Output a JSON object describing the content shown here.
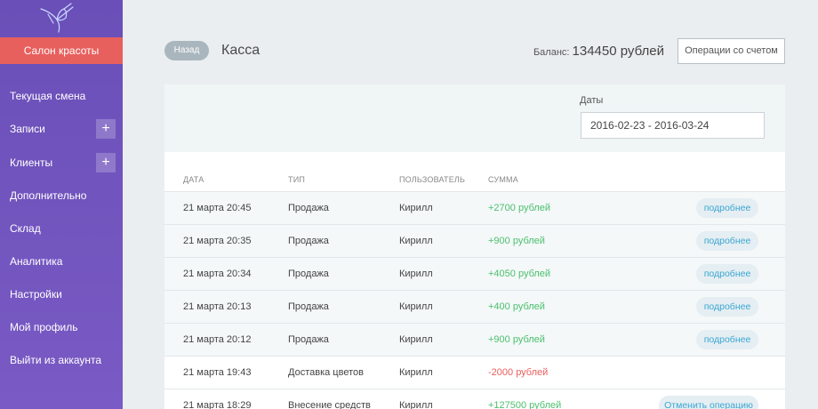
{
  "sidebar": {
    "salon_label": "Салон красоты",
    "items": [
      {
        "label": "Текущая смена",
        "has_plus": false
      },
      {
        "label": "Записи",
        "has_plus": true
      },
      {
        "label": "Клиенты",
        "has_plus": true
      },
      {
        "label": "Дополнительно",
        "has_plus": false
      },
      {
        "label": "Склад",
        "has_plus": false
      },
      {
        "label": "Аналитика",
        "has_plus": false
      },
      {
        "label": "Настройки",
        "has_plus": false
      },
      {
        "label": "Мой профиль",
        "has_plus": false
      },
      {
        "label": "Выйти из аккаунта",
        "has_plus": false
      }
    ],
    "plus_symbol": "+"
  },
  "header": {
    "back_label": "Назад",
    "title": "Касса",
    "balance_label": "Баланс:",
    "balance_value": "134450 рублей",
    "ops_button": "Операции со счетом"
  },
  "filter": {
    "dates_label": "Даты",
    "dates_value": "2016-02-23 - 2016-03-24"
  },
  "table": {
    "columns": [
      "Дата",
      "Тип",
      "Пользователь",
      "Сумма"
    ],
    "rows": [
      {
        "date": "21 марта 20:45",
        "type": "Продажа",
        "user": "Кирилл",
        "amount": "+2700 рублей",
        "positive": true,
        "action": "подробнее"
      },
      {
        "date": "21 марта 20:35",
        "type": "Продажа",
        "user": "Кирилл",
        "amount": "+900 рублей",
        "positive": true,
        "action": "подробнее"
      },
      {
        "date": "21 марта 20:34",
        "type": "Продажа",
        "user": "Кирилл",
        "amount": "+4050 рублей",
        "positive": true,
        "action": "подробнее"
      },
      {
        "date": "21 марта 20:13",
        "type": "Продажа",
        "user": "Кирилл",
        "amount": "+400 рублей",
        "positive": true,
        "action": "подробнее"
      },
      {
        "date": "21 марта 20:12",
        "type": "Продажа",
        "user": "Кирилл",
        "amount": "+900 рублей",
        "positive": true,
        "action": "подробнее"
      },
      {
        "date": "21 марта 19:43",
        "type": "Доставка цветов",
        "user": "Кирилл",
        "amount": "-2000 рублей",
        "positive": false,
        "action": ""
      },
      {
        "date": "21 марта 18:29",
        "type": "Внесение средств",
        "user": "Кирилл",
        "amount": "+127500 рублей",
        "positive": true,
        "action": "Отменить операцию"
      }
    ]
  },
  "colors": {
    "sidebar": "#6a4fb8",
    "salon_button": "#e8605e",
    "positive": "#4cc06e",
    "negative": "#e8605e",
    "link": "#3aa6d4"
  },
  "icons": {
    "logo": "hummingbird-logo-icon",
    "plus": "plus-icon"
  }
}
